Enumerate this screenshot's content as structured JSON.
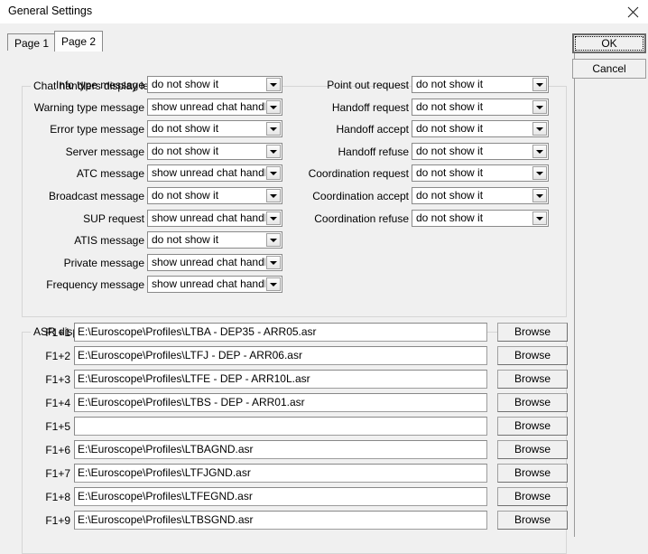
{
  "window": {
    "title": "General Settings",
    "close_icon": "close-icon"
  },
  "tabs": [
    {
      "label": "Page 1",
      "active": false
    },
    {
      "label": "Page 2",
      "active": true
    }
  ],
  "dialog_buttons": {
    "ok": "OK",
    "cancel": "Cancel"
  },
  "chat_group": {
    "title": "Chat handlers display levels",
    "left_rows": [
      {
        "label": "Info type message",
        "value": "do not show it"
      },
      {
        "label": "Warning type message",
        "value": "show unread chat handler"
      },
      {
        "label": "Error type message",
        "value": "do not show it"
      },
      {
        "label": "Server message",
        "value": "do not show it"
      },
      {
        "label": "ATC message",
        "value": "show unread chat handler"
      },
      {
        "label": "Broadcast message",
        "value": "do not show it"
      },
      {
        "label": "SUP request",
        "value": "show unread chat handler"
      },
      {
        "label": "ATIS message",
        "value": "do not show it"
      },
      {
        "label": "Private message",
        "value": "show unread chat handler"
      },
      {
        "label": "Frequency message",
        "value": "show unread chat handler"
      }
    ],
    "right_rows": [
      {
        "label": "Point out request",
        "value": "do not show it"
      },
      {
        "label": "Handoff request",
        "value": "do not show it"
      },
      {
        "label": "Handoff accept",
        "value": "do not show it"
      },
      {
        "label": "Handoff refuse",
        "value": "do not show it"
      },
      {
        "label": "Coordination request",
        "value": "do not show it"
      },
      {
        "label": "Coordination accept",
        "value": "do not show it"
      },
      {
        "label": "Coordination refuse",
        "value": "do not show it"
      }
    ]
  },
  "asr_group": {
    "title": "ASR display (fast keys) (saved at profile file)",
    "browse_label": "Browse",
    "rows": [
      {
        "key": "F1+1",
        "value": "E:\\Euroscope\\Profiles\\LTBA - DEP35 - ARR05.asr"
      },
      {
        "key": "F1+2",
        "value": "E:\\Euroscope\\Profiles\\LTFJ - DEP - ARR06.asr"
      },
      {
        "key": "F1+3",
        "value": "E:\\Euroscope\\Profiles\\LTFE - DEP - ARR10L.asr"
      },
      {
        "key": "F1+4",
        "value": "E:\\Euroscope\\Profiles\\LTBS - DEP - ARR01.asr"
      },
      {
        "key": "F1+5",
        "value": ""
      },
      {
        "key": "F1+6",
        "value": "E:\\Euroscope\\Profiles\\LTBAGND.asr"
      },
      {
        "key": "F1+7",
        "value": "E:\\Euroscope\\Profiles\\LTFJGND.asr"
      },
      {
        "key": "F1+8",
        "value": "E:\\Euroscope\\Profiles\\LTFEGND.asr"
      },
      {
        "key": "F1+9",
        "value": "E:\\Euroscope\\Profiles\\LTBSGND.asr"
      }
    ]
  },
  "colors": {
    "window_background": "#f0f0f0",
    "titlebar_background": "#ffffff",
    "field_background": "#ffffff",
    "border": "#8a8a8a",
    "group_border": "#d6d6d6"
  }
}
